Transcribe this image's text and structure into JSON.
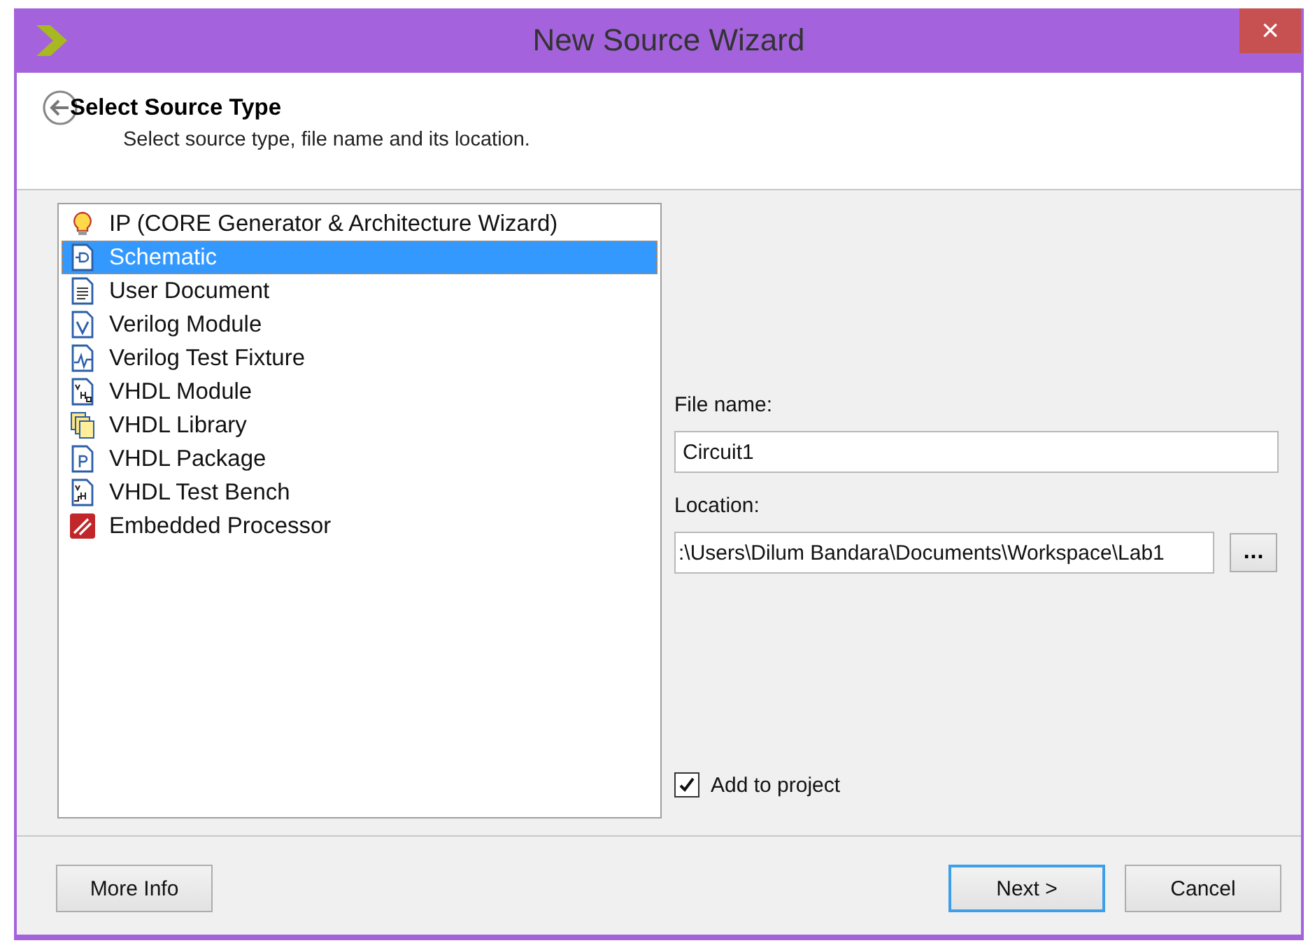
{
  "window": {
    "title": "New Source Wizard",
    "close": "×"
  },
  "header": {
    "title": "Select Source Type",
    "subtitle": "Select source type, file name and its location."
  },
  "source_types": [
    {
      "label": "IP (CORE Generator & Architecture Wizard)",
      "kind": "ip",
      "selected": false
    },
    {
      "label": "Schematic",
      "kind": "schematic",
      "selected": true
    },
    {
      "label": "User Document",
      "kind": "document",
      "selected": false
    },
    {
      "label": "Verilog Module",
      "kind": "verilog",
      "selected": false
    },
    {
      "label": "Verilog Test Fixture",
      "kind": "fixture",
      "selected": false
    },
    {
      "label": "VHDL Module",
      "kind": "vhdl",
      "selected": false
    },
    {
      "label": "VHDL Library",
      "kind": "library",
      "selected": false
    },
    {
      "label": "VHDL Package",
      "kind": "package",
      "selected": false
    },
    {
      "label": "VHDL Test Bench",
      "kind": "bench",
      "selected": false
    },
    {
      "label": "Embedded Processor",
      "kind": "processor",
      "selected": false
    }
  ],
  "file_name": {
    "label": "File name:",
    "value": "Circuit1"
  },
  "location": {
    "label": "Location:",
    "value": ":\\Users\\Dilum Bandara\\Documents\\Workspace\\Lab1",
    "browse": "..."
  },
  "add_to_project": {
    "label": "Add to project",
    "checked": true
  },
  "buttons": [
    {
      "label": "More Info",
      "default": false
    },
    {
      "label": "Next >",
      "default": true
    },
    {
      "label": "Cancel",
      "default": false
    }
  ]
}
